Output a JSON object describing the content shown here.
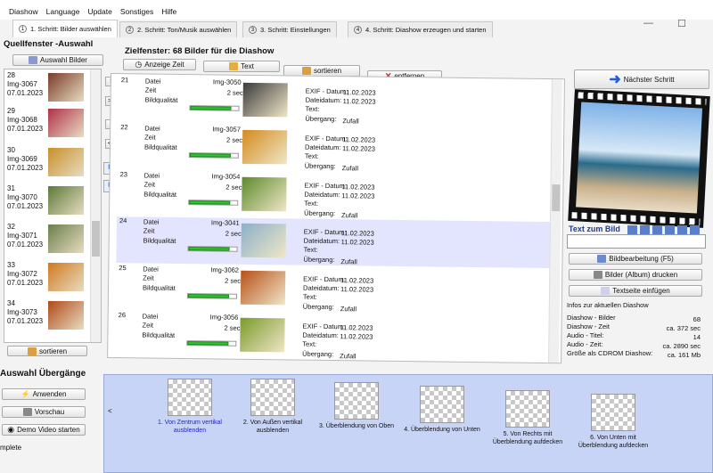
{
  "menu": [
    "Diashow",
    "Language",
    "Update",
    "Sonstiges",
    "Hilfe"
  ],
  "tabs": [
    {
      "label": "1. Schritt: Bilder auswählen",
      "num": "1"
    },
    {
      "label": "2. Schritt: Ton/Musik auswählen",
      "num": "2"
    },
    {
      "label": "3. Schritt: Einstellungen",
      "num": "3"
    },
    {
      "label": "4. Schritt: Diashow erzeugen und starten",
      "num": "4"
    }
  ],
  "source": {
    "title": "Quellfenster -Auswahl",
    "select_button": "Auswahl Bilder",
    "sort_button": "sortieren",
    "items": [
      {
        "num": "28",
        "name": "Img-3067",
        "date": "07.01.2023",
        "color": "#7a3b2a"
      },
      {
        "num": "29",
        "name": "Img-3068",
        "date": "07.01.2023",
        "color": "#b0304a"
      },
      {
        "num": "30",
        "name": "Img-3069",
        "date": "07.01.2023",
        "color": "#c8902a"
      },
      {
        "num": "31",
        "name": "Img-3070",
        "date": "07.01.2023",
        "color": "#5b7a3a"
      },
      {
        "num": "32",
        "name": "Img-3071",
        "date": "07.01.2023",
        "color": "#6a7f4a"
      },
      {
        "num": "33",
        "name": "Img-3072",
        "date": "07.01.2023",
        "color": "#d07a20"
      },
      {
        "num": "34",
        "name": "Img-3073",
        "date": "07.01.2023",
        "color": "#b04a18"
      }
    ]
  },
  "middle": {
    "btn_right": ">",
    "btn_all_right": ">>",
    "btn_left": "<",
    "btn_all_left": "<<"
  },
  "target": {
    "title": "Zielfenster: 68 Bilder für die Diashow",
    "toolbar": {
      "time": "Anzeige Zeit",
      "text": "Text",
      "sort": "sortieren",
      "remove": "entfernen"
    },
    "labels": {
      "file": "Datei",
      "time": "Zeit",
      "quality": "Bildqualität",
      "exif": "EXIF - Datum:",
      "filedate": "Dateidatum:",
      "text": "Text:",
      "transition": "Übergang:"
    },
    "items": [
      {
        "num": "21",
        "name": "Img-3050",
        "secs": "2 sec",
        "exif": "11.02.2023",
        "filedate": "11.02.2023",
        "transition": "Zufall",
        "color": "#3b3b3b",
        "quality": 0.85
      },
      {
        "num": "22",
        "name": "Img-3057",
        "secs": "2 sec",
        "exif": "11.02.2023",
        "filedate": "11.02.2023",
        "transition": "Zufall",
        "color": "#d48a1c",
        "quality": 0.85
      },
      {
        "num": "23",
        "name": "Img-3054",
        "secs": "2 sec",
        "exif": "11.02.2023",
        "filedate": "11.02.2023",
        "transition": "Zufall",
        "color": "#5c8a2a",
        "quality": 0.85
      },
      {
        "num": "24",
        "name": "Img-3041",
        "secs": "2 sec",
        "exif": "11.02.2023",
        "filedate": "11.02.2023",
        "transition": "Zufall",
        "color": "#8ab0c8",
        "quality": 0.85
      },
      {
        "num": "25",
        "name": "Img-3062",
        "secs": "2 sec",
        "exif": "11.02.2023",
        "filedate": "11.02.2023",
        "transition": "Zufall",
        "color": "#b85018",
        "quality": 0.85
      },
      {
        "num": "26",
        "name": "Img-3056",
        "secs": "2 sec",
        "exif": "11.02.2023",
        "filedate": "11.02.2023",
        "transition": "Zufall",
        "color": "#7a9a2a",
        "quality": 0.85
      }
    ]
  },
  "right": {
    "next_step": "Nächster Schritt",
    "text_to_image": "Text zum Bild",
    "text_input": "",
    "edit_button": "Bildbearbeitung (F5)",
    "print_button": "Bilder (Album) drucken",
    "textpage_button": "Textseite einfügen",
    "info_title": "Infos zur aktuellen Diashow",
    "info": [
      {
        "k": "Diashow - Bilder",
        "v": "68"
      },
      {
        "k": "Diashow - Zeit",
        "v": "ca. 372 sec"
      },
      {
        "k": "Audio - Titel:",
        "v": "14"
      },
      {
        "k": "Audio - Zeit:",
        "v": "ca. 2890 sec"
      },
      {
        "k": "Größe als CDROM Diashow:",
        "v": "ca. 161 Mb"
      }
    ]
  },
  "transitions": {
    "title": "Auswahl Übergänge",
    "apply": "Anwenden",
    "preview": "Vorschau",
    "demo": "Demo Video starten",
    "left_arrow": "<",
    "items": [
      {
        "label": "1. Von Zentrum vertikal ausblenden"
      },
      {
        "label": "2. Von Außen vertikal ausblenden"
      },
      {
        "label": "3. Überblendung von Oben"
      },
      {
        "label": "4. Überblendung von Unten"
      },
      {
        "label": "5. Von Rechts mit Überblendung aufdecken"
      },
      {
        "label": "6. Von Unten mit Überblendung aufdecken"
      }
    ]
  },
  "status": "mplete",
  "colors": {
    "accent": "#1f5ed8",
    "selected": "#1f1fcc",
    "bar": "#2ec82e",
    "strip": "#c8d4f5"
  }
}
